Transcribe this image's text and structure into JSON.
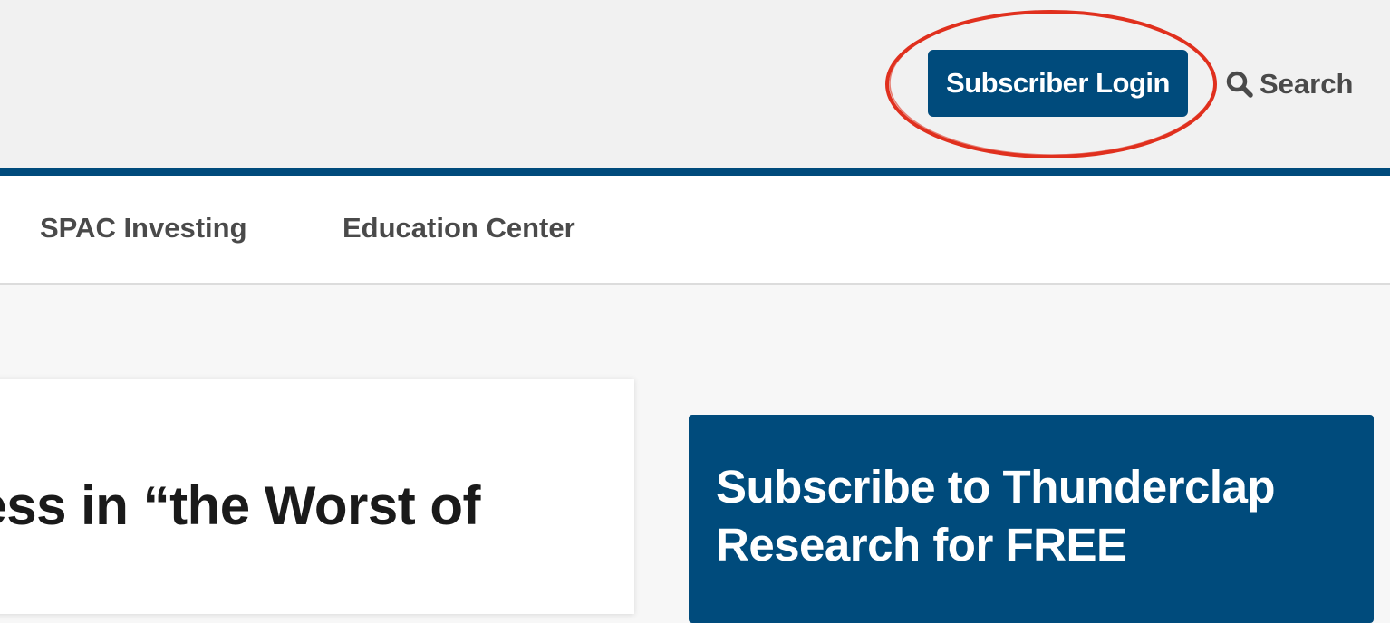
{
  "header": {
    "login_label": "Subscriber Login",
    "search_label": "Search",
    "accent_color": "#004b7c",
    "highlight_color": "#e0301e"
  },
  "nav": {
    "items": [
      {
        "label": "SPAC Investing"
      },
      {
        "label": "Education Center"
      }
    ]
  },
  "main": {
    "article_title": "cess in “the Worst of"
  },
  "sidebar": {
    "subscribe_title": "Subscribe to Thunderclap Research for FREE",
    "subscribe_body": ""
  }
}
